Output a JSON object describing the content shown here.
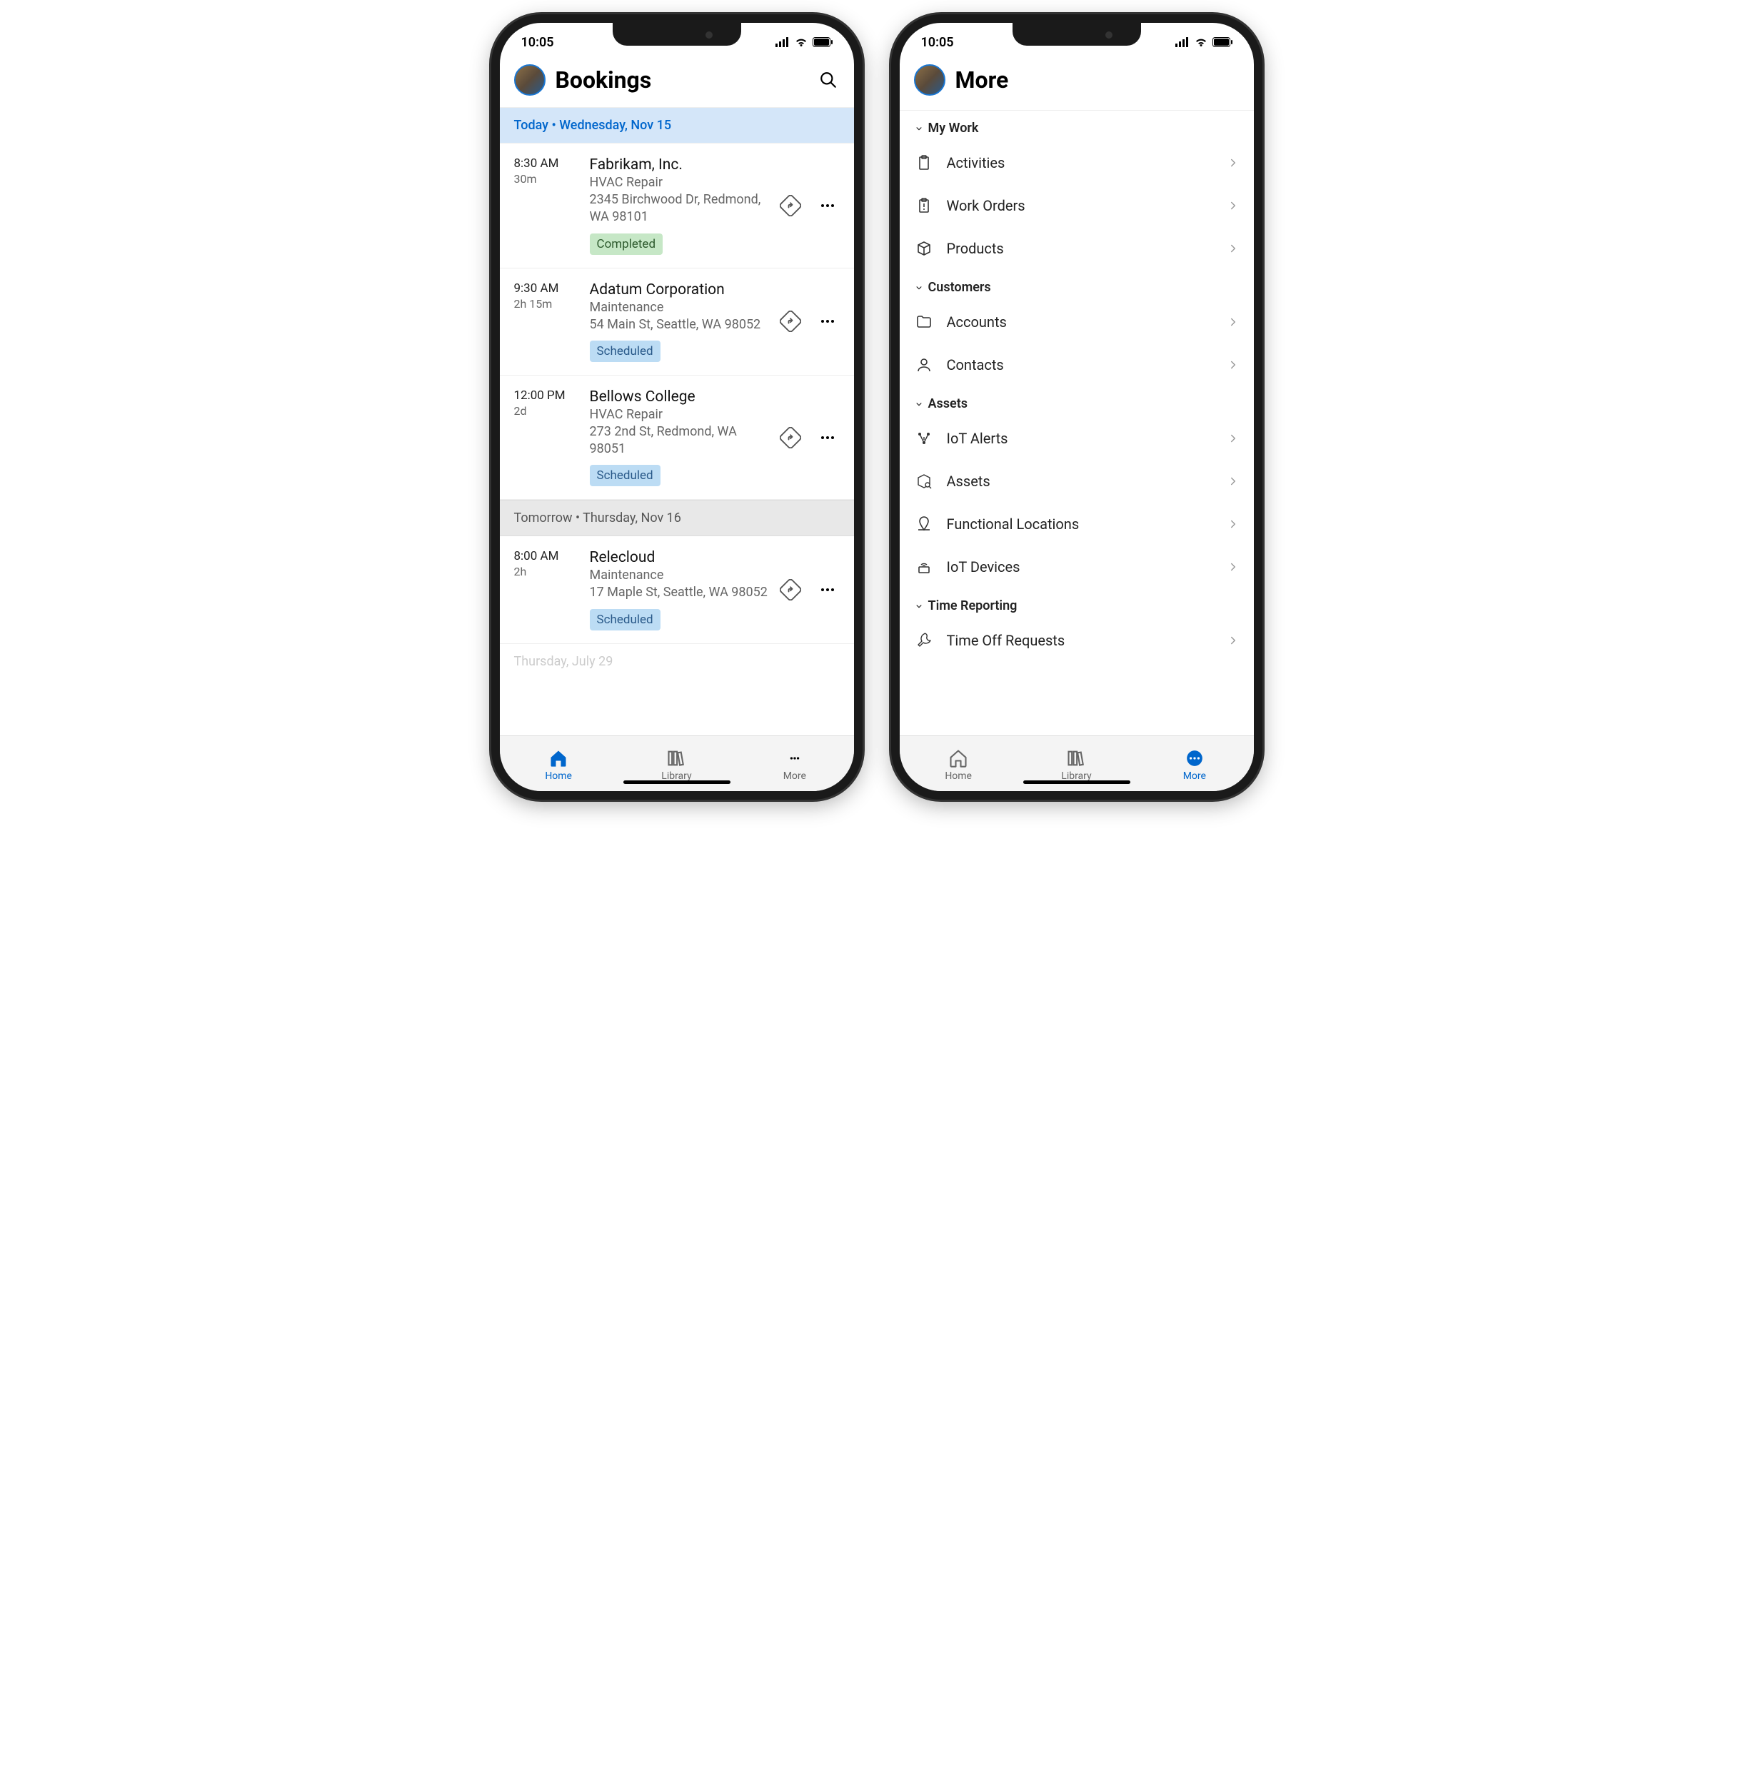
{
  "status": {
    "time": "10:05"
  },
  "left": {
    "title": "Bookings",
    "today_banner": "Today • Wednesday, Nov 15",
    "tomorrow_banner": "Tomorrow • Thursday, Nov 16",
    "faded_date": "Thursday, July 29",
    "bookings": [
      {
        "time": "8:30 AM",
        "dur": "30m",
        "title": "Fabrikam, Inc.",
        "sub": "HVAC Repair",
        "addr": "2345 Birchwood Dr, Redmond, WA 98101",
        "status": "Completed",
        "status_class": "badge-completed"
      },
      {
        "time": "9:30 AM",
        "dur": "2h 15m",
        "title": "Adatum Corporation",
        "sub": "Maintenance",
        "addr": "54 Main St, Seattle, WA 98052",
        "status": "Scheduled",
        "status_class": "badge-scheduled"
      },
      {
        "time": "12:00 PM",
        "dur": "2d",
        "title": "Bellows College",
        "sub": "HVAC Repair",
        "addr": "273 2nd St, Redmond, WA 98051",
        "status": "Scheduled",
        "status_class": "badge-scheduled"
      }
    ],
    "tomorrow_bookings": [
      {
        "time": "8:00 AM",
        "dur": "2h",
        "title": "Relecloud",
        "sub": "Maintenance",
        "addr": "17 Maple St, Seattle, WA 98052",
        "status": "Scheduled",
        "status_class": "badge-scheduled"
      }
    ],
    "tabs": {
      "home": "Home",
      "library": "Library",
      "more": "More"
    }
  },
  "right": {
    "title": "More",
    "sections": [
      {
        "name": "My Work",
        "items": [
          {
            "label": "Activities",
            "icon": "clipboard"
          },
          {
            "label": "Work Orders",
            "icon": "clipboard-alert"
          },
          {
            "label": "Products",
            "icon": "box"
          }
        ]
      },
      {
        "name": "Customers",
        "items": [
          {
            "label": "Accounts",
            "icon": "folder"
          },
          {
            "label": "Contacts",
            "icon": "person"
          }
        ]
      },
      {
        "name": "Assets",
        "items": [
          {
            "label": "IoT Alerts",
            "icon": "iot-alert"
          },
          {
            "label": "Assets",
            "icon": "box-search"
          },
          {
            "label": "Functional Locations",
            "icon": "location"
          },
          {
            "label": "IoT Devices",
            "icon": "iot-device"
          }
        ]
      },
      {
        "name": "Time Reporting",
        "items": [
          {
            "label": "Time Off Requests",
            "icon": "time-off"
          }
        ]
      }
    ],
    "tabs": {
      "home": "Home",
      "library": "Library",
      "more": "More"
    }
  }
}
